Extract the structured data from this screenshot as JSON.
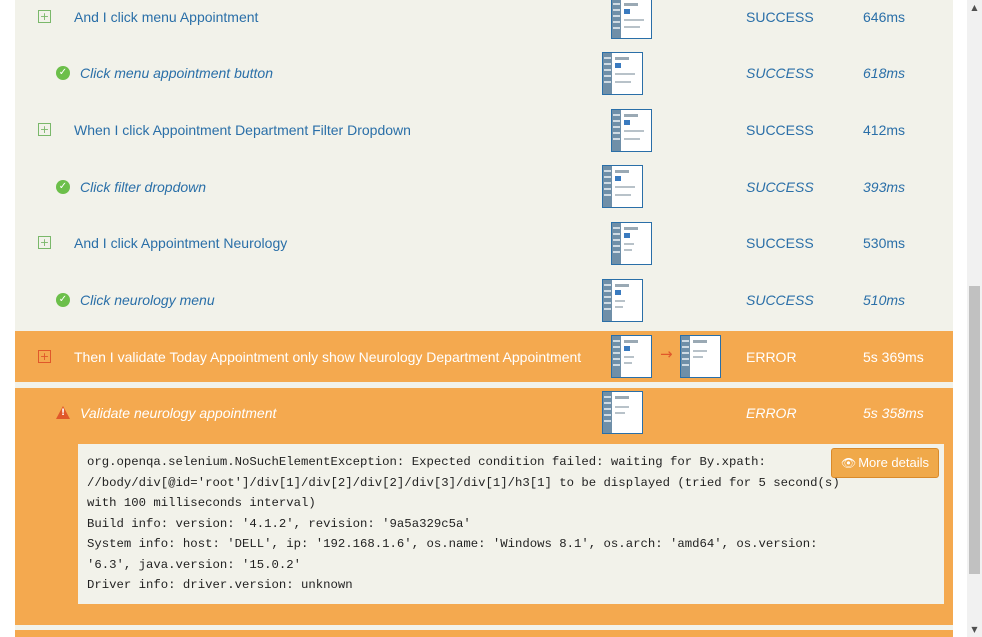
{
  "steps": [
    {
      "text": "And I click menu Appointment",
      "status": "SUCCESS",
      "duration": "646ms",
      "kind": "step"
    },
    {
      "text": "Click menu appointment button",
      "status": "SUCCESS",
      "duration": "618ms",
      "kind": "substep"
    },
    {
      "text": "When I click Appointment Department Filter Dropdown",
      "status": "SUCCESS",
      "duration": "412ms",
      "kind": "step"
    },
    {
      "text": "Click filter dropdown",
      "status": "SUCCESS",
      "duration": "393ms",
      "kind": "substep"
    },
    {
      "text": "And I click Appointment Neurology",
      "status": "SUCCESS",
      "duration": "530ms",
      "kind": "step"
    },
    {
      "text": "Click neurology menu",
      "status": "SUCCESS",
      "duration": "510ms",
      "kind": "substep"
    },
    {
      "text": "Then I validate Today Appointment only show Neurology Department Appointment",
      "status": "ERROR",
      "duration": "5s 369ms",
      "kind": "step-error"
    },
    {
      "text": "Validate neurology appointment",
      "status": "ERROR",
      "duration": "5s 358ms",
      "kind": "substep-error"
    }
  ],
  "error_log": [
    "org.openqa.selenium.NoSuchElementException: Expected condition failed: waiting for By.xpath:",
    "//body/div[@id='root']/div[1]/div[2]/div[2]/div[3]/div[1]/h3[1] to be displayed (tried for 5 second(s)",
    "with 100 milliseconds interval)",
    "Build info: version: '4.1.2', revision: '9a5a329c5a'",
    "System info: host: 'DELL', ip: '192.168.1.6', os.name: 'Windows 8.1', os.arch: 'amd64', os.version:",
    "'6.3', java.version: '15.0.2'",
    "Driver info: driver.version: unknown"
  ],
  "more_details_label": "More details",
  "icons": {
    "expand": "plus-square-icon",
    "success": "check-circle-icon",
    "error": "warning-triangle-icon",
    "more": "eye-icon"
  },
  "colors": {
    "link": "#2a6fa8",
    "error_bg": "#f4a94f",
    "success": "#6cbf4a",
    "error_accent": "#e0582a"
  }
}
